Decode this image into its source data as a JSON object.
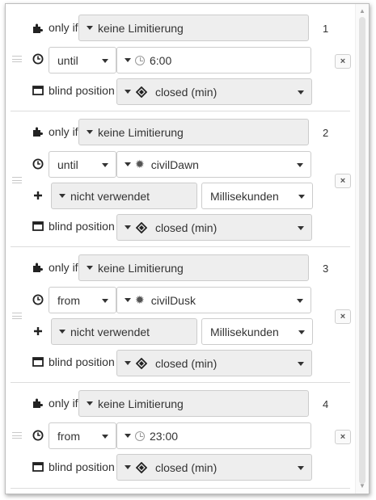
{
  "labels": {
    "only_if": "only if",
    "blind_position": "blind position"
  },
  "icons": {
    "puzzle": "puzzle-icon",
    "clock": "clock-icon",
    "plus": "plus-icon",
    "window": "window-icon",
    "sun": "sun-icon",
    "diamond": "up-down-diamond-icon",
    "remove": "remove-icon"
  },
  "rules": [
    {
      "number": "1",
      "condition": "keine Limitierung",
      "time_mode": "until",
      "time_value": "6:00",
      "time_kind": "fixed",
      "position": "closed (min)",
      "delete": "×"
    },
    {
      "number": "2",
      "condition": "keine Limitierung",
      "time_mode": "until",
      "time_value": "civilDawn",
      "time_kind": "sun",
      "offset": "nicht verwendet",
      "offset_unit": "Millisekunden",
      "position": "closed (min)",
      "delete": "×"
    },
    {
      "number": "3",
      "condition": "keine Limitierung",
      "time_mode": "from",
      "time_value": "civilDusk",
      "time_kind": "sun",
      "offset": "nicht verwendet",
      "offset_unit": "Millisekunden",
      "position": "closed (min)",
      "delete": "×"
    },
    {
      "number": "4",
      "condition": "keine Limitierung",
      "time_mode": "from",
      "time_value": "23:00",
      "time_kind": "fixed",
      "position": "closed (min)",
      "delete": "×"
    }
  ]
}
